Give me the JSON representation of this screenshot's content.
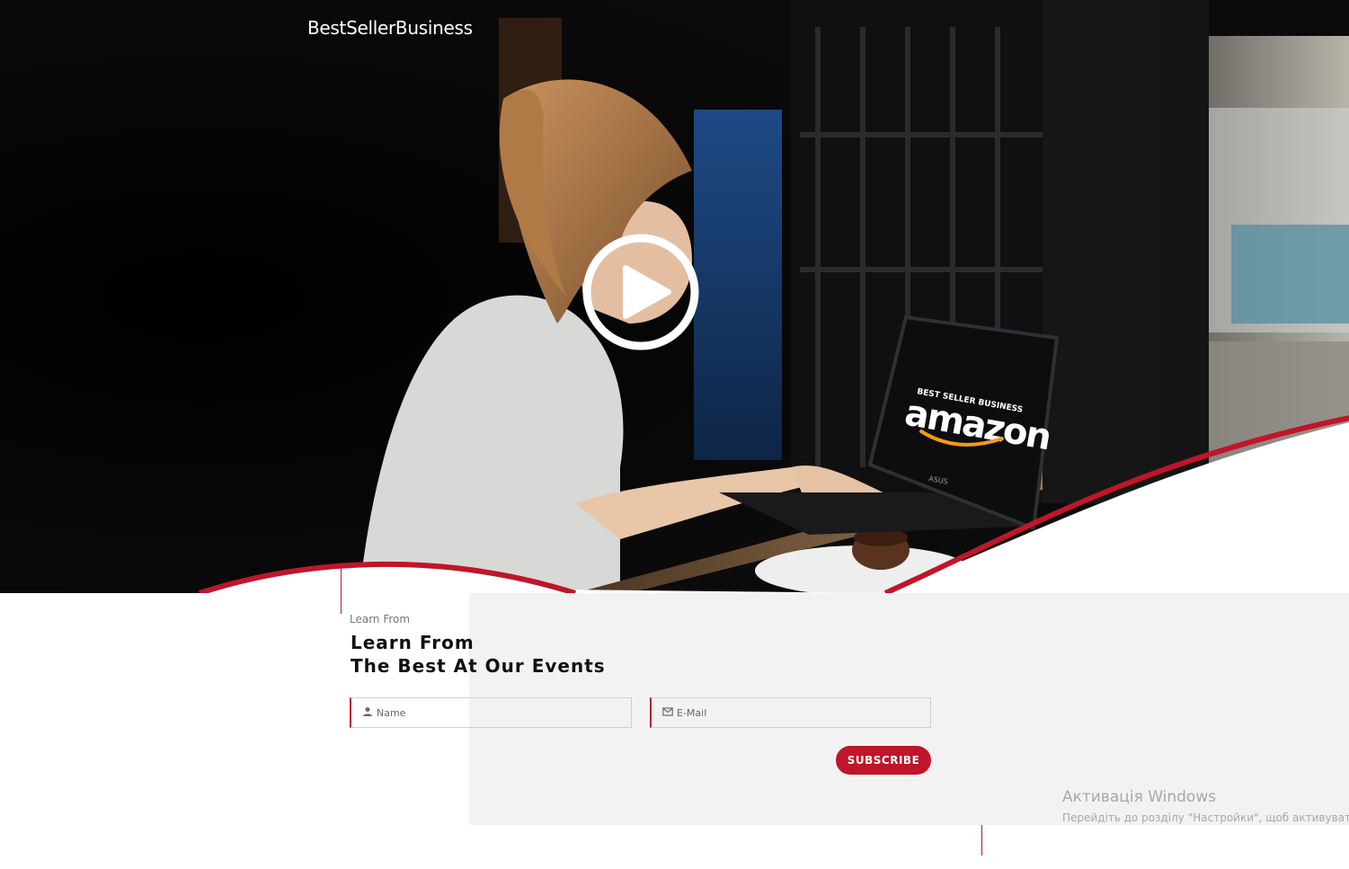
{
  "brand": {
    "name": "BestSellerBusiness"
  },
  "hero": {
    "play_label": "Play video",
    "laptop_screen": {
      "top_text": "BEST SELLER BUSINESS",
      "logo_text": "amazon",
      "laptop_brand": "ASUS"
    }
  },
  "events": {
    "subtitle": "Learn From",
    "heading_line1": "Learn From",
    "heading_line2": "The Best At Our Events"
  },
  "form": {
    "name_placeholder": "Name",
    "email_placeholder": "E-Mail",
    "subscribe_label": "SUBSCRIBE"
  },
  "windows_watermark": {
    "title": "Активація Windows",
    "subtitle": "Перейдіть до розділу \"Настройки\", щоб активувати Windows."
  },
  "colors": {
    "accent": "#c0152a",
    "hero_dark": "#070707",
    "panel_grey": "#f2f2f2"
  },
  "icons": [
    "play-icon",
    "user-icon",
    "mail-icon"
  ]
}
